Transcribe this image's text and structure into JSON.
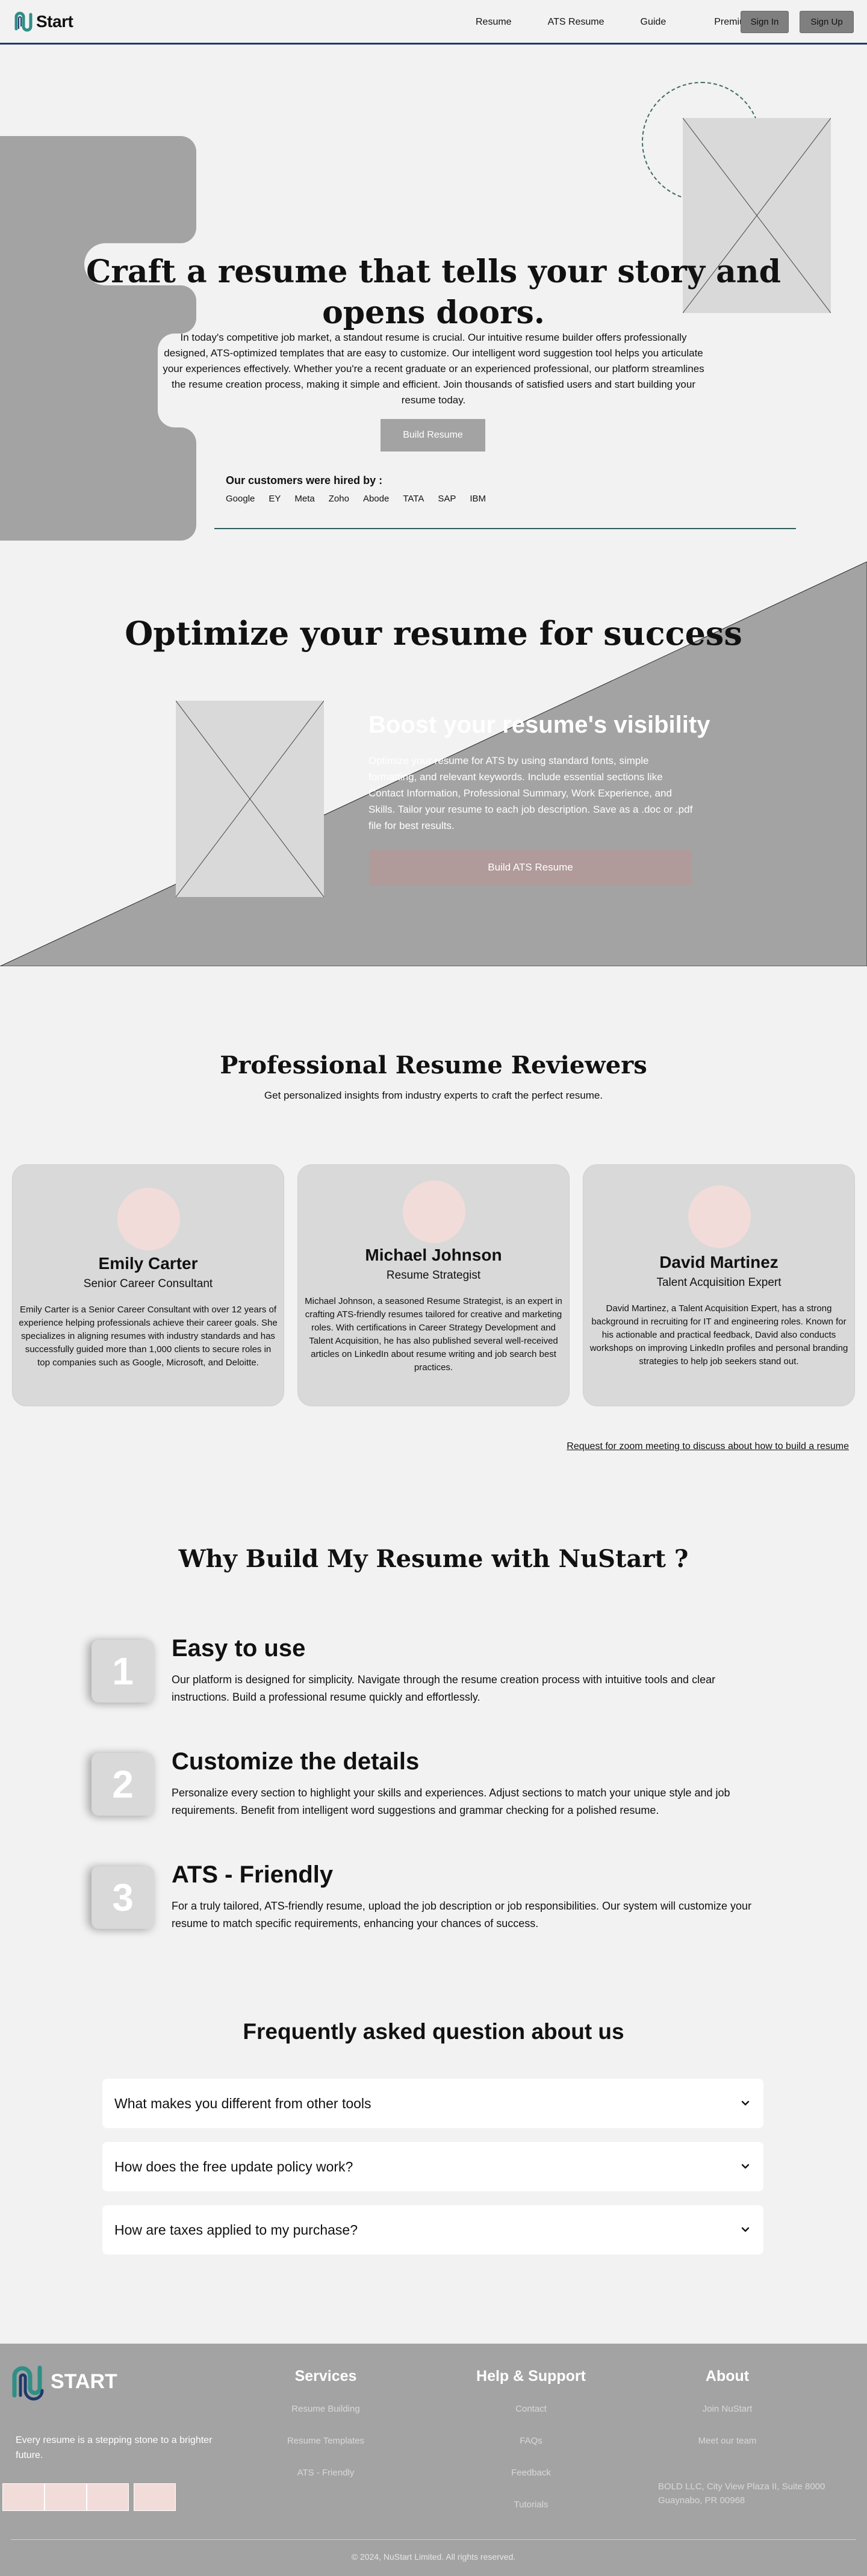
{
  "nav": {
    "logo_text": "Start",
    "links": [
      "Resume",
      "ATS Resume",
      "Guide",
      "Premium"
    ],
    "signin": "Sign In",
    "signup": "Sign Up"
  },
  "hero": {
    "title": "Craft a resume that tells your story and opens doors.",
    "description": "In today's competitive job market, a standout resume is crucial. Our intuitive resume builder offers professionally designed, ATS-optimized templates that are easy to customize. Our intelligent word suggestion tool helps you articulate your experiences effectively. Whether you're a recent graduate or an experienced professional, our platform streamlines the resume creation process, making it simple and efficient. Join thousands of satisfied users and start building your resume today.",
    "button": "Build Resume",
    "hired_title": "Our customers were hired by :",
    "companies": [
      "Google",
      "EY",
      "Meta",
      "Zoho",
      "Abode",
      "TATA",
      "SAP",
      "IBM"
    ]
  },
  "optimize": {
    "title": "Optimize your resume for success",
    "subtitle": "Boost your resume's visibility",
    "text": "Optimize your resume for ATS by using standard fonts, simple formatting, and relevant keywords. Include essential sections like Contact Information, Professional Summary, Work Experience, and Skills. Tailor your resume to each job description. Save as a .doc or .pdf file for best results.",
    "button": "Build ATS Resume"
  },
  "reviewers": {
    "title": "Professional Resume Reviewers",
    "subtitle": "Get personalized insights from industry experts to craft the perfect resume.",
    "cards": [
      {
        "name": "Emily Carter",
        "role": "Senior Career Consultant",
        "bio": "Emily Carter is a Senior Career Consultant with over 12 years of experience helping professionals achieve their career goals. She specializes in aligning resumes with industry standards and has successfully guided more than 1,000 clients to secure roles in top companies such as Google, Microsoft, and Deloitte."
      },
      {
        "name": "Michael Johnson",
        "role": "Resume Strategist",
        "bio": "Michael Johnson, a seasoned Resume Strategist, is an expert in crafting ATS-friendly resumes tailored for creative and marketing roles. With certifications in Career Strategy Development and Talent Acquisition, he has also published several well-received articles on LinkedIn about resume writing and job search best practices."
      },
      {
        "name": "David Martinez",
        "role": "Talent Acquisition Expert",
        "bio": "David Martinez, a Talent Acquisition Expert, has a strong background in recruiting for IT and engineering roles. Known for his actionable and practical feedback, David also conducts workshops on improving LinkedIn profiles and personal branding strategies to help job seekers stand out."
      }
    ],
    "zoom_link": "Request for zoom meeting to discuss about how to build a resume"
  },
  "why": {
    "title": "Why Build My Resume with NuStart ?",
    "items": [
      {
        "num": "1",
        "heading": "Easy to use",
        "text": "Our platform is designed for simplicity. Navigate through the resume creation process with intuitive tools and clear instructions. Build a professional resume quickly and effortlessly."
      },
      {
        "num": "2",
        "heading": "Customize the details",
        "text": "Personalize every section to highlight your skills and experiences. Adjust sections to match your unique style and job requirements. Benefit from intelligent word suggestions and grammar checking for a polished resume."
      },
      {
        "num": "3",
        "heading": "ATS - Friendly",
        "text": "For a truly tailored, ATS-friendly resume, upload the job description or job responsibilities. Our system will customize your resume to match specific requirements, enhancing your chances of success."
      }
    ]
  },
  "faq": {
    "title": "Frequently asked question about us",
    "questions": [
      "What makes you different from other tools",
      "How does the free update policy work?",
      "How are taxes applied to my purchase?"
    ]
  },
  "footer": {
    "logo_text": "START",
    "tagline": "Every resume is a stepping stone to a brighter future.",
    "services_heading": "Services",
    "services": [
      "Resume Building",
      "Resume Templates",
      "ATS - Friendly"
    ],
    "support_heading": "Help & Support",
    "support": [
      "Contact",
      "FAQs",
      "Feedback",
      "Tutorials"
    ],
    "about_heading": "About",
    "about": [
      "Join NuStart",
      "Meet our team"
    ],
    "address": "BOLD LLC, City View Plaza II, Suite 8000 Guaynabo, PR 00968",
    "copyright": "© 2024, NuStart Limited. All rights reserved."
  },
  "colors": {
    "accent_teal": "#2f8f86",
    "logo_dark": "#1f3a6b",
    "gray": "#a3a3a3",
    "pink": "#f2dcd9"
  }
}
